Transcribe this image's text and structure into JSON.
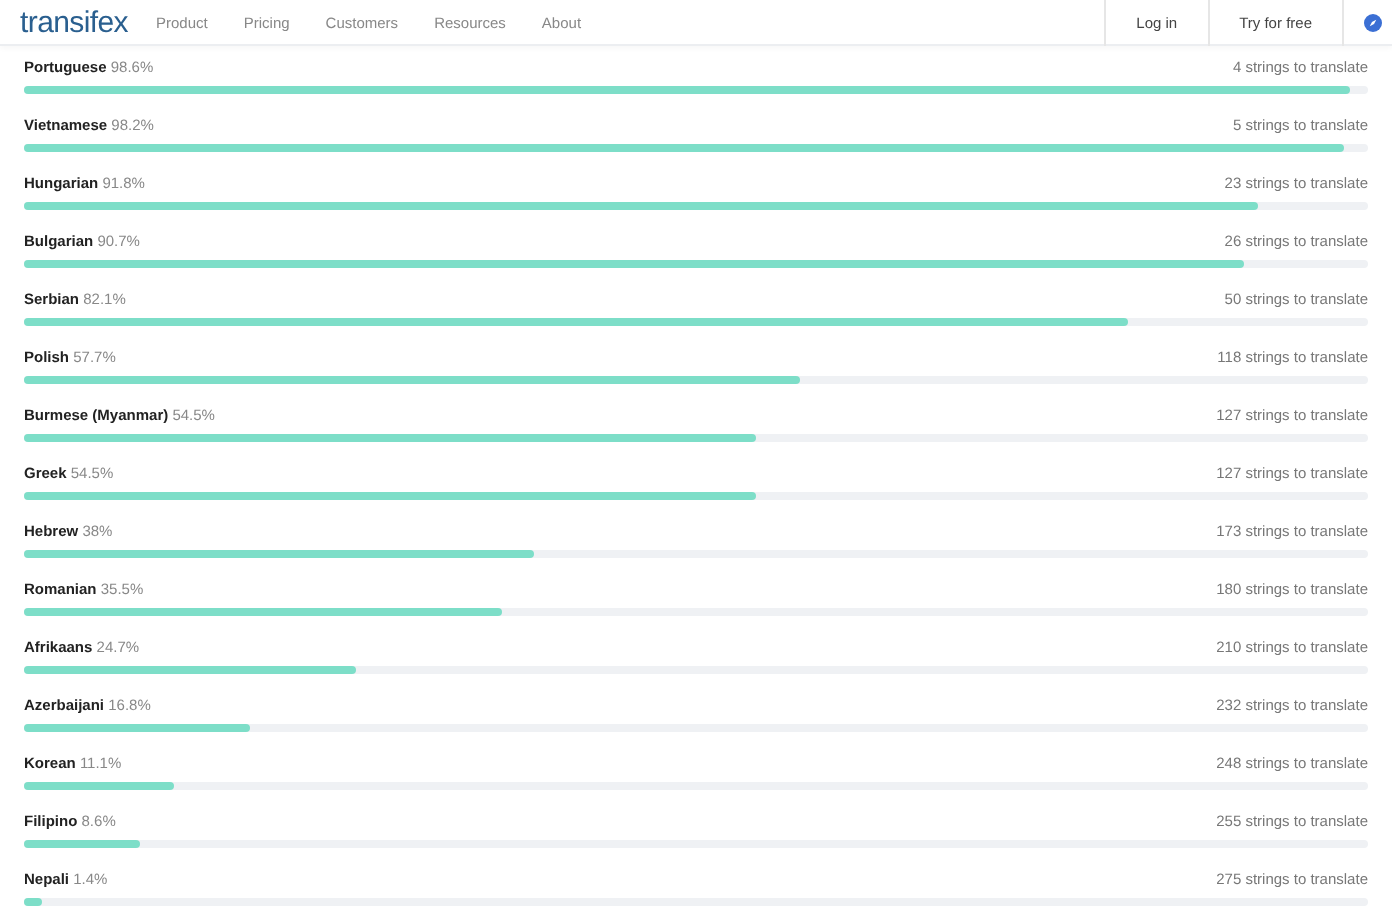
{
  "navbar": {
    "logo": "transifex",
    "links": [
      "Product",
      "Pricing",
      "Customers",
      "Resources",
      "About"
    ],
    "login": "Log in",
    "trial": "Try for free"
  },
  "languages": [
    {
      "name": "Portuguese",
      "percent": "98.6%",
      "level": 0.986,
      "remaining": "4 strings to translate"
    },
    {
      "name": "Vietnamese",
      "percent": "98.2%",
      "level": 0.982,
      "remaining": "5 strings to translate"
    },
    {
      "name": "Hungarian",
      "percent": "91.8%",
      "level": 0.918,
      "remaining": "23 strings to translate"
    },
    {
      "name": "Bulgarian",
      "percent": "90.7%",
      "level": 0.907,
      "remaining": "26 strings to translate"
    },
    {
      "name": "Serbian",
      "percent": "82.1%",
      "level": 0.821,
      "remaining": "50 strings to translate"
    },
    {
      "name": "Polish",
      "percent": "57.7%",
      "level": 0.577,
      "remaining": "118 strings to translate"
    },
    {
      "name": "Burmese (Myanmar)",
      "percent": "54.5%",
      "level": 0.545,
      "remaining": "127 strings to translate"
    },
    {
      "name": "Greek",
      "percent": "54.5%",
      "level": 0.545,
      "remaining": "127 strings to translate"
    },
    {
      "name": "Hebrew",
      "percent": "38%",
      "level": 0.38,
      "remaining": "173 strings to translate"
    },
    {
      "name": "Romanian",
      "percent": "35.5%",
      "level": 0.355,
      "remaining": "180 strings to translate"
    },
    {
      "name": "Afrikaans",
      "percent": "24.7%",
      "level": 0.247,
      "remaining": "210 strings to translate"
    },
    {
      "name": "Azerbaijani",
      "percent": "16.8%",
      "level": 0.168,
      "remaining": "232 strings to translate"
    },
    {
      "name": "Korean",
      "percent": "11.1%",
      "level": 0.111,
      "remaining": "248 strings to translate"
    },
    {
      "name": "Filipino",
      "percent": "8.6%",
      "level": 0.086,
      "remaining": "255 strings to translate"
    },
    {
      "name": "Nepali",
      "percent": "1.4%",
      "level": 0.014,
      "remaining": "275 strings to translate"
    }
  ]
}
